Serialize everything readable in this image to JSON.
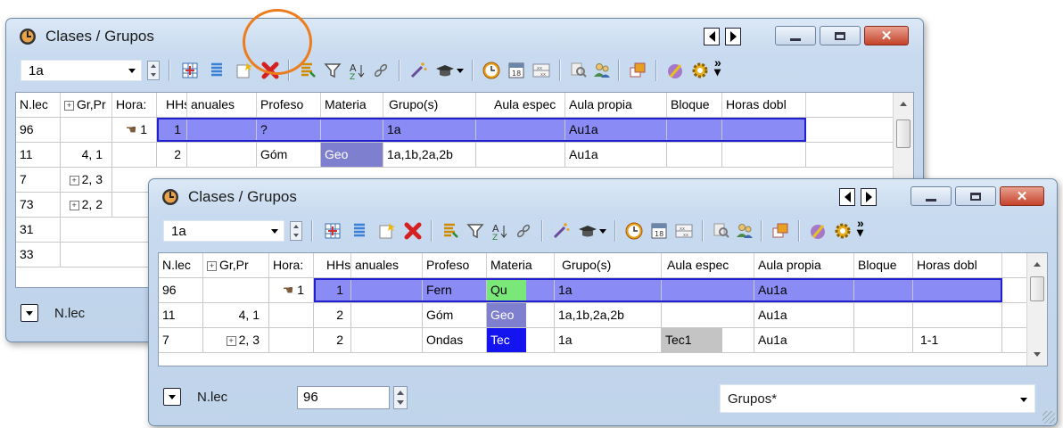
{
  "back_window": {
    "title": "Clases / Grupos",
    "combo_value": "1a",
    "columns": [
      "N.lec",
      "Gr,Pr",
      "Hora:",
      "HHs",
      "anuales",
      "Profeso",
      "Materia",
      "Grupo(s)",
      "Aula espec",
      "Aula propia",
      "Bloque",
      "Horas dobl"
    ],
    "rows": [
      {
        "nlec": "96",
        "grpr": "",
        "hora": "1",
        "hhs": "1",
        "anuales": "",
        "prof": "?",
        "materia": "",
        "grupos": "1a",
        "aula_espec": "",
        "aula_propia": "Au1a",
        "bloque": "",
        "horas_dobl": ""
      },
      {
        "nlec": "11",
        "grpr": "4, 1",
        "hora": "",
        "hhs": "2",
        "anuales": "",
        "prof": "Góm",
        "materia": "Geo",
        "grupos": "1a,1b,2a,2b",
        "aula_espec": "",
        "aula_propia": "Au1a",
        "bloque": "",
        "horas_dobl": ""
      },
      {
        "nlec": "7",
        "grpr": "2, 3",
        "hora": "",
        "hhs": "",
        "anuales": "",
        "prof": "",
        "materia": "",
        "grupos": "",
        "aula_espec": "",
        "aula_propia": "",
        "bloque": "",
        "horas_dobl": ""
      },
      {
        "nlec": "73",
        "grpr": "2, 2",
        "hora": "",
        "hhs": "",
        "anuales": "",
        "prof": "",
        "materia": "",
        "grupos": "",
        "aula_espec": "",
        "aula_propia": "",
        "bloque": "",
        "horas_dobl": ""
      },
      {
        "nlec": "31",
        "grpr": "",
        "hora": "",
        "hhs": "",
        "anuales": "",
        "prof": "",
        "materia": "",
        "grupos": "",
        "aula_espec": "",
        "aula_propia": "",
        "bloque": "",
        "horas_dobl": ""
      },
      {
        "nlec": "33",
        "grpr": "",
        "hora": "",
        "hhs": "",
        "anuales": "",
        "prof": "",
        "materia": "",
        "grupos": "",
        "aula_espec": "",
        "aula_propia": "",
        "bloque": "",
        "horas_dobl": ""
      }
    ],
    "footer_label": "N.lec"
  },
  "front_window": {
    "title": "Clases / Grupos",
    "combo_value": "1a",
    "columns": [
      "N.lec",
      "Gr,Pr",
      "Hora:",
      "HHs",
      "anuales",
      "Profeso",
      "Materia",
      "Grupo(s)",
      "Aula espec",
      "Aula propia",
      "Bloque",
      "Horas dobl"
    ],
    "rows": [
      {
        "nlec": "96",
        "grpr": "",
        "hora": "1",
        "hhs": "1",
        "anuales": "",
        "prof": "Fern",
        "materia": "Qu",
        "grupos": "1a",
        "aula_espec": "",
        "aula_propia": "Au1a",
        "bloque": "",
        "horas_dobl": ""
      },
      {
        "nlec": "11",
        "grpr": "4, 1",
        "hora": "",
        "hhs": "2",
        "anuales": "",
        "prof": "Góm",
        "materia": "Geo",
        "grupos": "1a,1b,2a,2b",
        "aula_espec": "",
        "aula_propia": "Au1a",
        "bloque": "",
        "horas_dobl": ""
      },
      {
        "nlec": "7",
        "grpr": "2, 3",
        "hora": "",
        "hhs": "2",
        "anuales": "",
        "prof": "Ondas",
        "materia": "Tec",
        "grupos": "1a",
        "aula_espec": "Tec1",
        "aula_propia": "Au1a",
        "bloque": "",
        "horas_dobl": "1-1"
      }
    ],
    "footer_label": "N.lec",
    "footer_input": "96",
    "footer_combo": "Grupos*"
  },
  "colors": {
    "selected_row": "#8b8bf5",
    "materia_qu": "#79e879",
    "materia_geo": "#7f7fcf",
    "materia_tec": "#1414f0",
    "aula_espec_tec1": "#c4c4c4",
    "highlight_ring": "#ec7d1e"
  },
  "toolbar_icons": [
    "grid-icon",
    "list-icon",
    "new-icon",
    "delete-icon",
    "report-icon",
    "filter-icon",
    "sort-icon",
    "link-icon",
    "magic-icon",
    "teacher-icon",
    "clock-icon",
    "calendar-icon",
    "matrix-icon",
    "search-icon",
    "users-icon",
    "windows-icon",
    "edit-icon",
    "settings-icon"
  ]
}
